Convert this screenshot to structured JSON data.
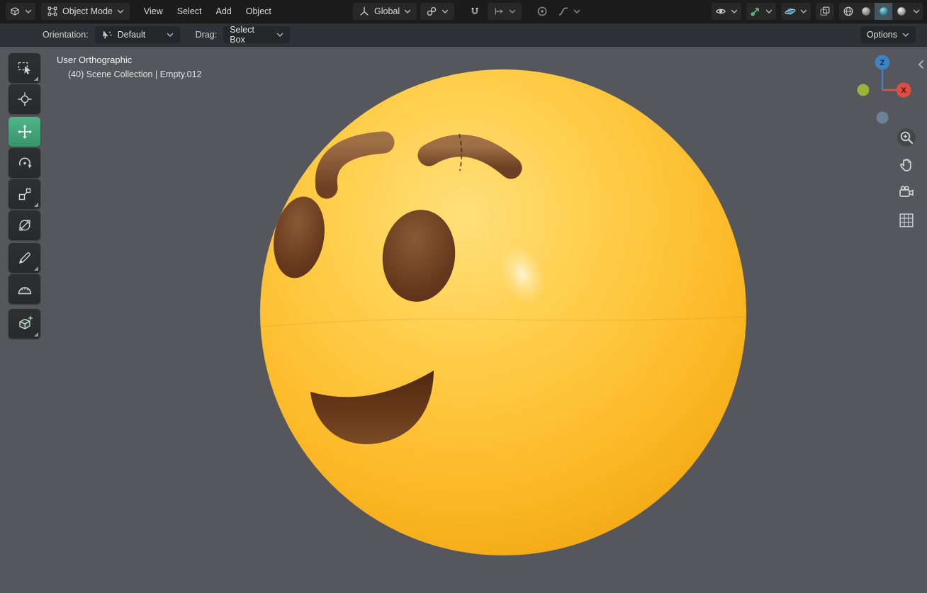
{
  "header": {
    "mode": "Object Mode",
    "menus": [
      "View",
      "Select",
      "Add",
      "Object"
    ],
    "orientation": "Global",
    "shading_modes": [
      "wireframe",
      "solid",
      "material-preview",
      "rendered"
    ],
    "shading_active": "material-preview"
  },
  "tool_settings": {
    "orientation_label": "Orientation:",
    "orientation_value": "Default",
    "drag_label": "Drag:",
    "drag_value": "Select Box",
    "options_label": "Options"
  },
  "viewport": {
    "view_label": "User Orthographic",
    "breadcrumb": "(40) Scene Collection | Empty.012"
  },
  "nav_gizmo": {
    "z_label": "Z",
    "x_label": "X"
  },
  "tools": [
    {
      "name": "select-box",
      "active": false,
      "has_subtools": true
    },
    {
      "name": "cursor",
      "active": false,
      "has_subtools": false
    },
    {
      "name": "move",
      "active": true,
      "has_subtools": false
    },
    {
      "name": "rotate",
      "active": false,
      "has_subtools": false
    },
    {
      "name": "scale",
      "active": false,
      "has_subtools": true
    },
    {
      "name": "transform",
      "active": false,
      "has_subtools": false
    },
    {
      "name": "annotate",
      "active": false,
      "has_subtools": true
    },
    {
      "name": "measure",
      "active": false,
      "has_subtools": false
    },
    {
      "name": "add-cube",
      "active": false,
      "has_subtools": true
    }
  ],
  "icons": {
    "editor-type-icon": "wire-cube",
    "object-mode-icon": "square-with-corner-dots",
    "orientation-axis-icon": "axis-tripod",
    "pivot-point-icon": "linked-circles",
    "snap-magnet-icon": "magnet",
    "snap-target-icon": "snap-to-arrow",
    "proportional-editing-icon": "circle-dot",
    "falloff-curve-icon": "smooth-curve",
    "visibility-eye-icon": "eye",
    "gizmo-toggle-icon": "green-axis-arrow",
    "overlays-toggle-icon": "sphere-with-ring",
    "xray-toggle-icon": "overlapping-squares",
    "shading-wireframe-icon": "wire-sphere",
    "shading-solid-icon": "gray-sphere",
    "shading-material-icon": "teal-sphere",
    "shading-rendered-icon": "lit-sphere",
    "tweak-cursor-icon": "cursor-with-dots",
    "zoom-icon": "magnifier-plus",
    "pan-icon": "hand",
    "camera-view-icon": "movie-camera",
    "grid-ortho-icon": "grid",
    "chevron-down-icon": "v",
    "collapse-arrow-icon": "<"
  },
  "colors": {
    "active_tool": "#3fa57c",
    "axis_x": "#dd4e40",
    "axis_z": "#3d82c4",
    "axis_neg_y": "#9fb838",
    "axis_neg_z": "#7186a2",
    "emoji_base": "#ffc642",
    "emoji_features": "#6e4226",
    "toggle_green": "#63bd8b",
    "toggle_blue": "#58a7c9"
  }
}
